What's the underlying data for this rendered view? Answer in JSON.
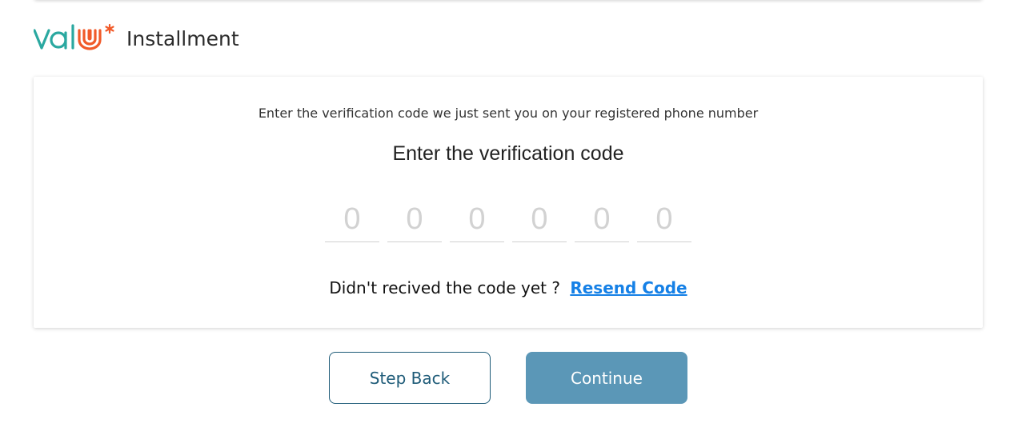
{
  "brand": {
    "logo_text": "valu*",
    "title": "Installment",
    "colors": {
      "teal": "#2aa8a0",
      "orange": "#f15a29"
    }
  },
  "verification": {
    "instruction": "Enter the verification code we just sent you on your registered phone number",
    "heading": "Enter the verification code",
    "digits": [
      {
        "value": "",
        "placeholder": "0"
      },
      {
        "value": "",
        "placeholder": "0"
      },
      {
        "value": "",
        "placeholder": "0"
      },
      {
        "value": "",
        "placeholder": "0"
      },
      {
        "value": "",
        "placeholder": "0"
      },
      {
        "value": "",
        "placeholder": "0"
      }
    ],
    "resend_prompt": "Didn't recived the code yet ?",
    "resend_link": "Resend Code",
    "link_color": "#1580e6"
  },
  "actions": {
    "back_label": "Step Back",
    "continue_label": "Continue",
    "continue_color": "#5b97b7",
    "back_border_color": "#1e5b78"
  }
}
